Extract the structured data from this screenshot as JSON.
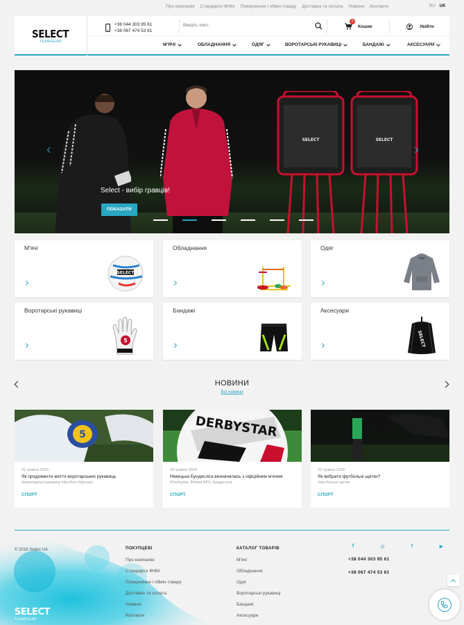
{
  "top_links": [
    "Про компанію",
    "Стандарти ФІФА",
    "Повернення і обмін товару",
    "Доставка та оплата",
    "Новини",
    "Контакти"
  ],
  "languages": [
    {
      "code": "RU",
      "active": false
    },
    {
      "code": "UK",
      "active": true
    }
  ],
  "header": {
    "logo_main": "SELECT",
    "logo_sub": "TEAMGEAR",
    "phones": [
      "+38 044 303 95 61",
      "+38 067 474 53 81"
    ],
    "search_placeholder": "Введіть текст",
    "cart_label": "Кошик",
    "cart_count": "0",
    "login_label": "Увійти"
  },
  "nav": [
    "М'ЯЧІ",
    "ОБЛАДНАННЯ",
    "ОДЯГ",
    "ВОРОТАРСЬКІ РУКАВИЦІ",
    "БАНДАЖІ",
    "АКСЕСУАРИ"
  ],
  "hero": {
    "caption": "Select - вибір гравців!",
    "button": "ПОКАЗАТИ",
    "dummy_logo": "SELECT",
    "active_slide": 1,
    "slide_count": 6
  },
  "categories": [
    {
      "title": "М'ячі",
      "icon": "ball-icon"
    },
    {
      "title": "Обладнання",
      "icon": "equipment-icon"
    },
    {
      "title": "Одяг",
      "icon": "hoodie-icon"
    },
    {
      "title": "Воротарські рукавиці",
      "icon": "glove-icon"
    },
    {
      "title": "Бандажі",
      "icon": "shorts-icon"
    },
    {
      "title": "Аксесуари",
      "icon": "bag-icon"
    }
  ],
  "news": {
    "title": "НОВИНИ",
    "all_link": "Всі новини",
    "items": [
      {
        "date": "31 травня 2018",
        "title": "Як продовжити життя воротарських рукавиць",
        "tags": "#воротарські рукавиці #футбол #футзал",
        "category": "СПОРТ"
      },
      {
        "date": "29 травня 2018",
        "title": "Німецька Бундесліга визначилась з офіційним м'ячем",
        "tags": "#Derbystar, Brillant APS, Бундесліга",
        "category": "СПОРТ"
      },
      {
        "date": "22 травня 2018",
        "title": "Як вибрати футбольні щитки?",
        "tags": "#футбольні щитки",
        "category": "СПОРТ"
      }
    ]
  },
  "footer": {
    "copyright": "© 2018 Select UA",
    "logo_main": "SELECT",
    "logo_sub": "TEAMGEAR",
    "buyers_heading": "ПОКУПЦЕВІ",
    "buyers_links": [
      "Про компанію",
      "Стандарти ФІФА",
      "Повернення і обмін товару",
      "Доставка та оплата",
      "Новини",
      "Контакти"
    ],
    "catalog_heading": "КАТАЛОГ ТОВАРІВ",
    "catalog_links": [
      "М'ячі",
      "Обладнання",
      "Одяг",
      "Воротарські рукавиці",
      "Бандажі",
      "Аксесуари"
    ],
    "socials": [
      "f",
      "◎",
      "t",
      "▶"
    ],
    "phones": [
      "+38 044 303 95 61",
      "+38 067 474 53 81"
    ]
  },
  "colors": {
    "accent": "#2aa6c3",
    "badge": "#e4342c",
    "background": "#f2f2f2"
  }
}
